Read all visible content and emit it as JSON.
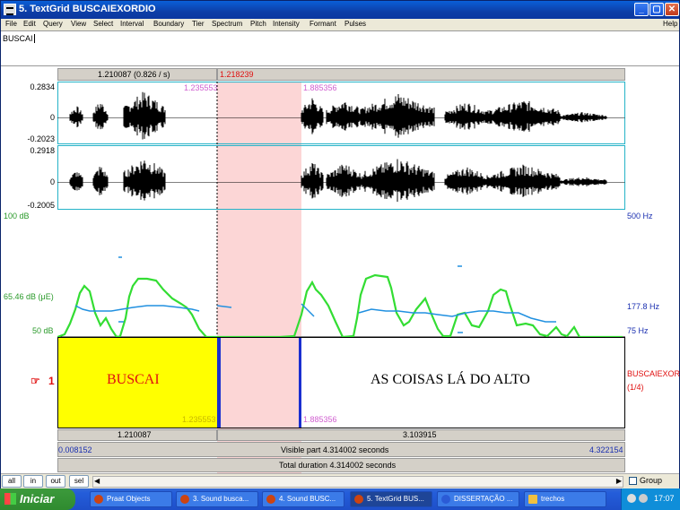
{
  "window": {
    "title": "5. TextGrid BUSCAIEXORDIO"
  },
  "menu": [
    "File",
    "Edit",
    "Query",
    "View",
    "Select",
    "Interval",
    "Boundary",
    "Tier",
    "Spectrum",
    "Pitch",
    "Intensity",
    "Formant",
    "Pulses"
  ],
  "help": "Help",
  "text_field": "BUSCAI",
  "top_bar": {
    "left": "1.210087 (0.826 / s)",
    "right": "1.218239"
  },
  "wave1": {
    "max": "0.2834",
    "zero": "0",
    "min": "-0.2023",
    "cursor_left": "1.235553",
    "cursor_right": "1.885356"
  },
  "wave2": {
    "max": "0.2918",
    "zero": "0",
    "min": "-0.2005"
  },
  "spectro": {
    "db_top": "100 dB",
    "db_mid": "65.46 dB (μE)",
    "db_bottom": "50 dB",
    "hz_top": "500 Hz",
    "hz_mid": "177.8 Hz",
    "hz_bottom": "75 Hz"
  },
  "tier": {
    "number": "1",
    "name": "BUSCAIEXOR",
    "count": "(1/4)",
    "intervals": [
      "BUSCAI",
      "AS COISAS LÁ DO ALTO"
    ],
    "bottom_left_time": "1.235553",
    "bottom_right_time": "1.885356"
  },
  "durations": {
    "left": "1.210087",
    "right": "3.103915"
  },
  "visible": {
    "start": "0.008152",
    "label": "Visible part 4.314002 seconds",
    "end": "4.322154"
  },
  "total": "Total duration 4.314002 seconds",
  "buttons": {
    "all": "all",
    "in": "in",
    "out": "out",
    "sel": "sel",
    "group": "Group"
  },
  "taskbar": {
    "start": "Iniciar",
    "tasks": [
      "Praat Objects",
      "3. Sound busca...",
      "4. Sound BUSC...",
      "5. TextGrid BUS...",
      "DISSERTAÇÃO ...",
      "trechos"
    ],
    "clock": "17:07"
  },
  "colors": {
    "selection": "#fcd6d6",
    "interval_fill": "#ffff00",
    "boundary": "#1a2fd0",
    "intensity": "#33dd33",
    "pitch": "#2090e0",
    "tier_label": "#e01010"
  }
}
